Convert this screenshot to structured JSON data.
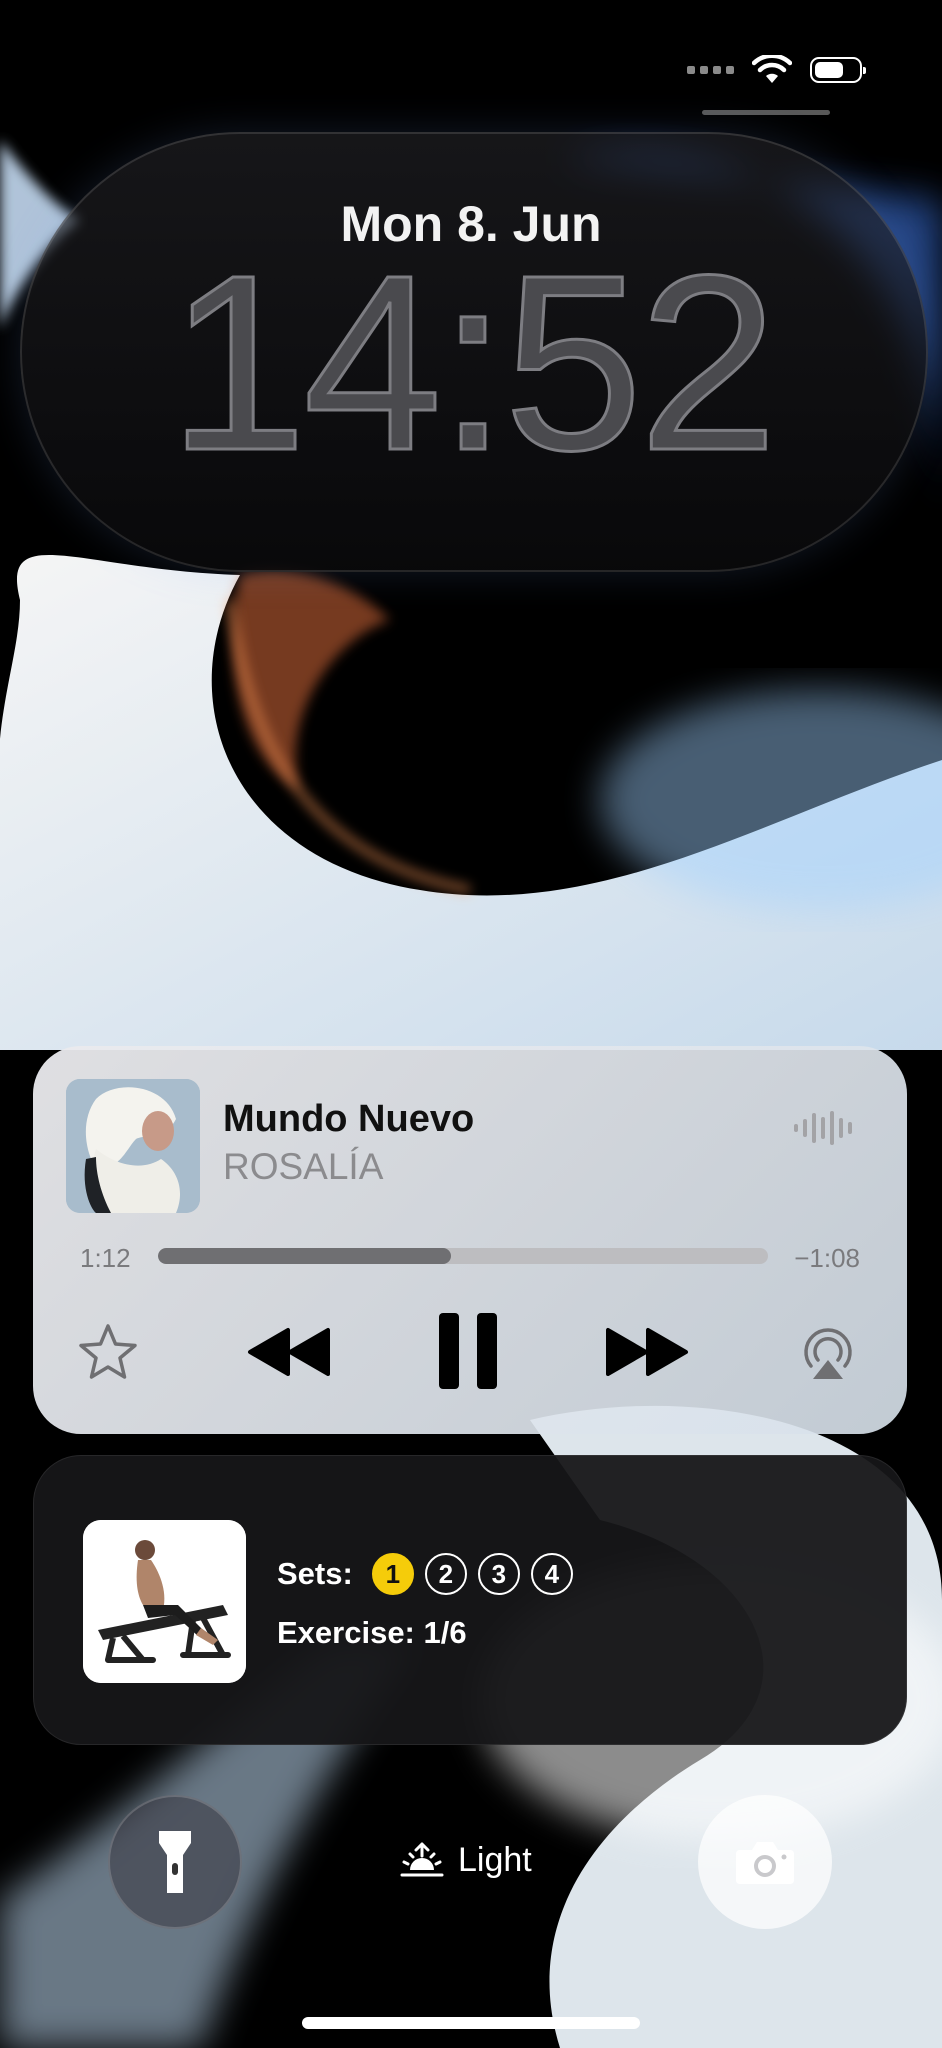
{
  "lock_screen": {
    "date": "Mon 8. Jun",
    "time": "14:52"
  },
  "status_bar": {
    "icons": [
      "cellular-signal-icon",
      "wifi-icon",
      "battery-icon"
    ]
  },
  "now_playing": {
    "title": "Mundo Nuevo",
    "artist": "ROSALÍA",
    "elapsed": "1:12",
    "remaining": "−1:08",
    "progress": 0.48,
    "controls": [
      "star-icon",
      "rewind-icon",
      "pause-icon",
      "fast-forward-icon",
      "airplay-icon"
    ]
  },
  "workout": {
    "sets_label": "Sets:",
    "sets": [
      "1",
      "2",
      "3",
      "4"
    ],
    "active_set": "1",
    "exercise": "Exercise: 1/6"
  },
  "bottom_controls": {
    "light_label": "Light"
  },
  "colors": {
    "set_active": "#f5cc0a",
    "card_light": "#e6e6e9",
    "card_dark": "#161618"
  }
}
